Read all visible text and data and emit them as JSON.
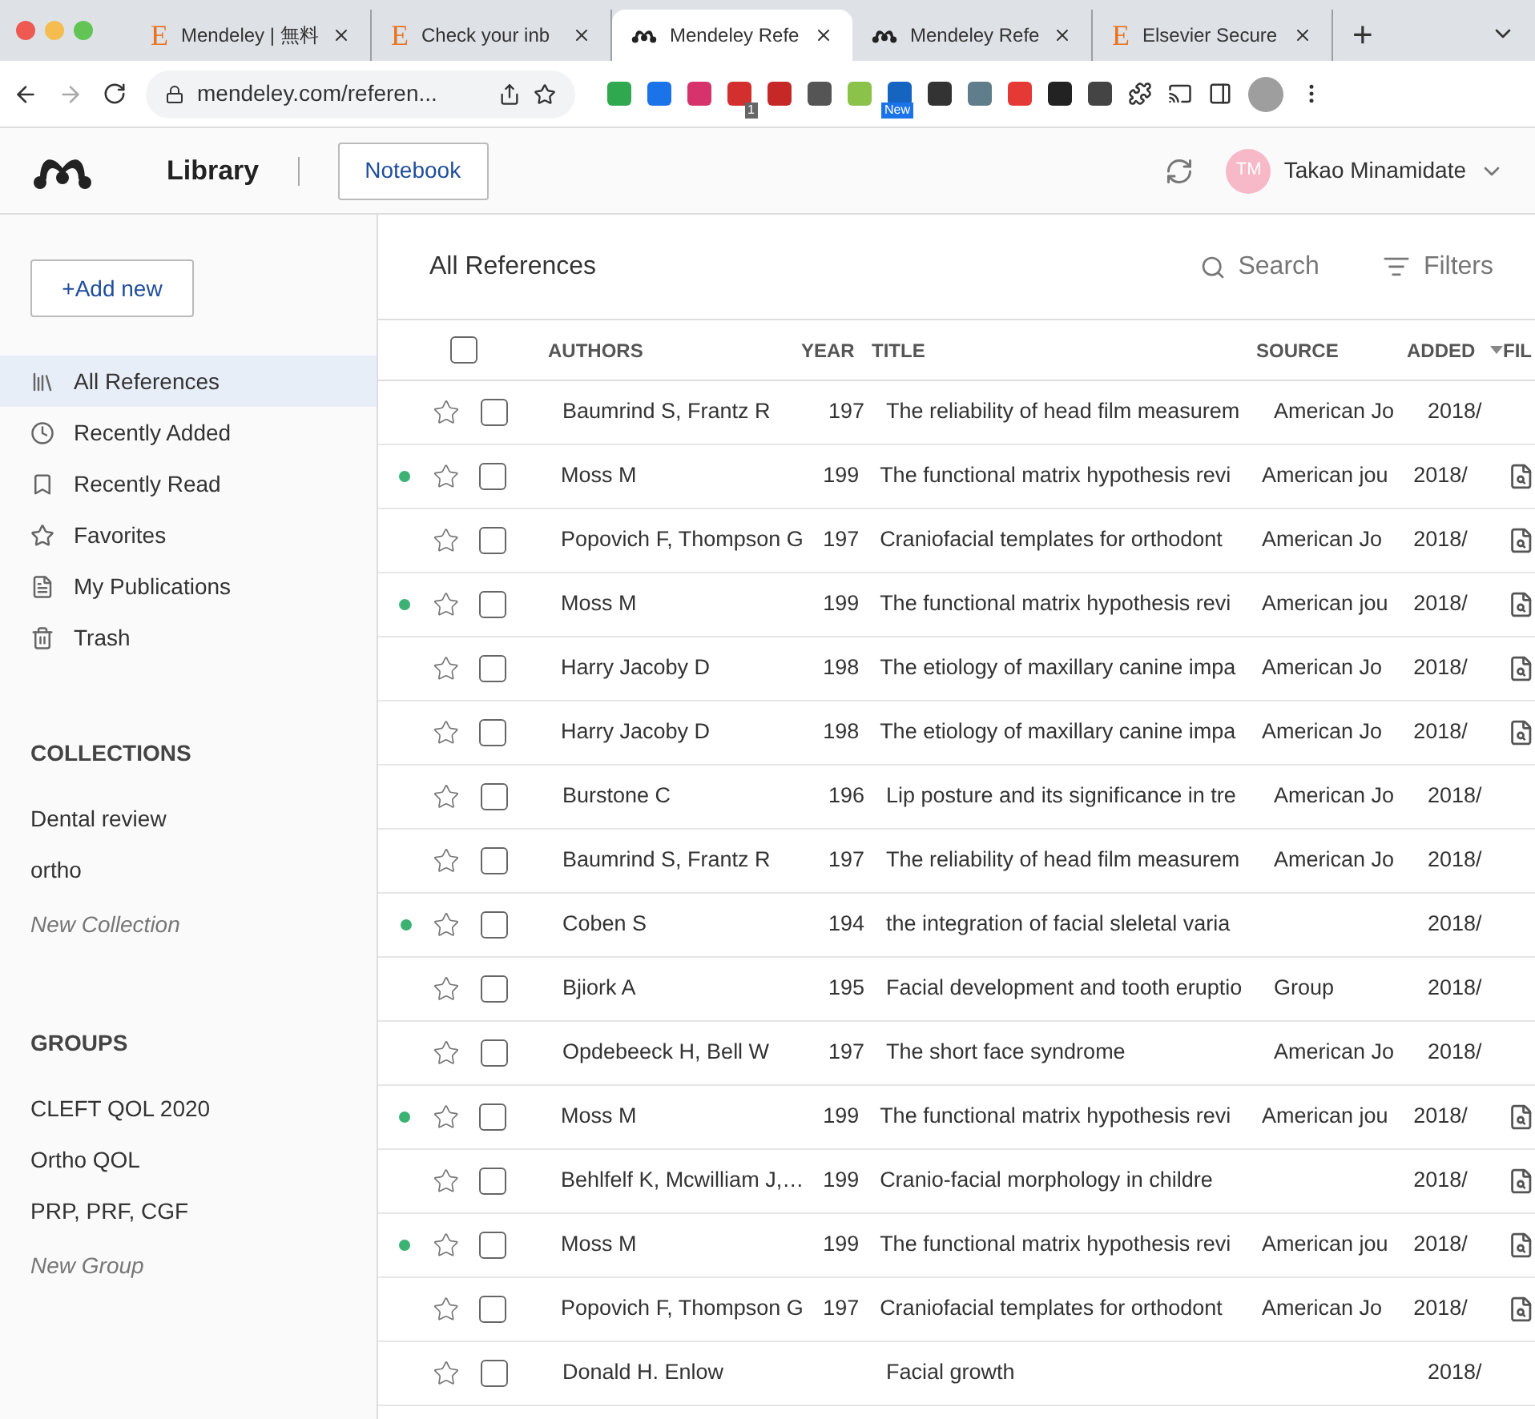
{
  "browser": {
    "tabs": [
      {
        "title": "Mendeley | 無料",
        "kind": "elsevier",
        "icon_text": "E",
        "selected": false
      },
      {
        "title": "Check your inb",
        "kind": "elsevier",
        "icon_text": "E",
        "selected": false
      },
      {
        "title": "Mendeley Refe",
        "kind": "mendeley",
        "selected": true
      },
      {
        "title": "Mendeley Refe",
        "kind": "mendeley",
        "selected": false
      },
      {
        "title": "Elsevier Secure",
        "kind": "elsevier",
        "icon_text": "E",
        "selected": false
      }
    ],
    "new_tab": "+",
    "address": "mendeley.com/referen...",
    "badges": {
      "count": "1",
      "new": "New"
    }
  },
  "app": {
    "title": "Library",
    "notebook_button": "Notebook",
    "user": {
      "initials": "TM",
      "name": "Takao Minamidate"
    }
  },
  "sidebar": {
    "add_new": "+Add new",
    "items": [
      {
        "label": "All References",
        "selected": true
      },
      {
        "label": "Recently Added",
        "selected": false
      },
      {
        "label": "Recently Read",
        "selected": false
      },
      {
        "label": "Favorites",
        "selected": false
      },
      {
        "label": "My Publications",
        "selected": false
      },
      {
        "label": "Trash",
        "selected": false
      }
    ],
    "collections": {
      "heading": "COLLECTIONS",
      "items": [
        "Dental review",
        "ortho"
      ],
      "new": "New Collection"
    },
    "groups": {
      "heading": "GROUPS",
      "items": [
        "CLEFT QOL 2020",
        "Ortho QOL",
        "PRP, PRF, CGF"
      ],
      "new": "New Group"
    }
  },
  "main": {
    "title": "All References",
    "search": "Search",
    "filters": "Filters",
    "select_all_checked": false,
    "columns": [
      "AUTHORS",
      "YEAR",
      "TITLE",
      "SOURCE",
      "ADDED",
      "FIL"
    ],
    "rows": [
      {
        "unread": false,
        "checked": false,
        "authors": "Baumrind S, Frantz R",
        "year": "197",
        "title": "The reliability of head film measurem",
        "source": "American Jo",
        "added": "2018/",
        "file": false
      },
      {
        "unread": true,
        "checked": false,
        "authors": "Moss M",
        "year": "199",
        "title": "The functional matrix hypothesis revi",
        "source": "American jou",
        "added": "2018/",
        "file": true
      },
      {
        "unread": false,
        "checked": false,
        "authors": "Popovich F, Thompson G",
        "year": "197",
        "title": "Craniofacial templates for orthodont",
        "source": "American Jo",
        "added": "2018/",
        "file": true
      },
      {
        "unread": true,
        "checked": false,
        "authors": "Moss M",
        "year": "199",
        "title": "The functional matrix hypothesis revi",
        "source": "American jou",
        "added": "2018/",
        "file": true
      },
      {
        "unread": false,
        "checked": false,
        "authors": "Harry Jacoby D",
        "year": "198",
        "title": "The etiology of maxillary canine impa",
        "source": "American Jo",
        "added": "2018/",
        "file": true
      },
      {
        "unread": false,
        "checked": false,
        "authors": "Harry Jacoby D",
        "year": "198",
        "title": "The etiology of maxillary canine impa",
        "source": "American Jo",
        "added": "2018/",
        "file": true
      },
      {
        "unread": false,
        "checked": false,
        "authors": "Burstone C",
        "year": "196",
        "title": "Lip posture and its significance in tre",
        "source": "American Jo",
        "added": "2018/",
        "file": false
      },
      {
        "unread": false,
        "checked": false,
        "authors": "Baumrind S, Frantz R",
        "year": "197",
        "title": "The reliability of head film measurem",
        "source": "American Jo",
        "added": "2018/",
        "file": false
      },
      {
        "unread": true,
        "checked": false,
        "authors": "Coben S",
        "year": "194",
        "title": "the integration of facial sleletal varia",
        "source": "",
        "added": "2018/",
        "file": false
      },
      {
        "unread": false,
        "checked": false,
        "authors": "Bjiork A",
        "year": "195",
        "title": "Facial development and tooth eruptio",
        "source": "Group",
        "added": "2018/",
        "file": false
      },
      {
        "unread": false,
        "checked": false,
        "authors": "Opdebeeck H, Bell W",
        "year": "197",
        "title": "The short face syndrome",
        "source": "American Jo",
        "added": "2018/",
        "file": false
      },
      {
        "unread": true,
        "checked": false,
        "authors": "Moss M",
        "year": "199",
        "title": "The functional matrix hypothesis revi",
        "source": "American jou",
        "added": "2018/",
        "file": true
      },
      {
        "unread": false,
        "checked": false,
        "authors": "Behlfelf K, Mcwilliam J,…",
        "year": "199",
        "title": "Cranio-facial morphology in childre",
        "source": "",
        "added": "2018/",
        "file": true
      },
      {
        "unread": true,
        "checked": false,
        "authors": "Moss M",
        "year": "199",
        "title": "The functional matrix hypothesis revi",
        "source": "American jou",
        "added": "2018/",
        "file": true
      },
      {
        "unread": false,
        "checked": false,
        "authors": "Popovich F, Thompson G",
        "year": "197",
        "title": "Craniofacial templates for orthodont",
        "source": "American Jo",
        "added": "2018/",
        "file": true
      },
      {
        "unread": false,
        "checked": false,
        "authors": "Donald H. Enlow",
        "year": "",
        "title": "Facial growth",
        "source": "",
        "added": "2018/",
        "file": false
      }
    ]
  }
}
